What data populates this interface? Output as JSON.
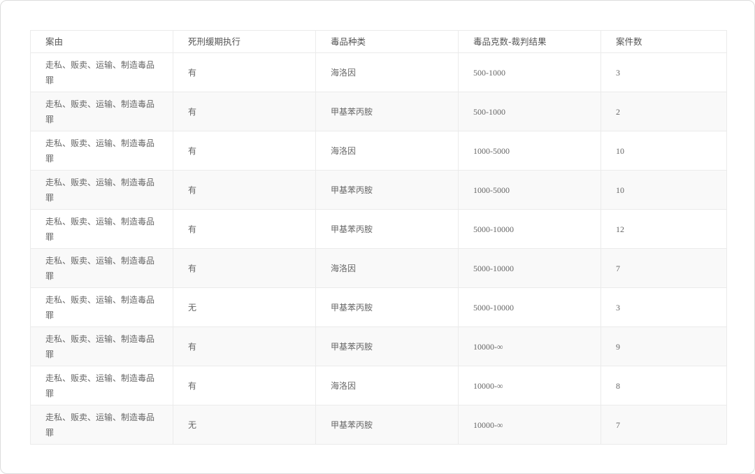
{
  "table": {
    "headers": [
      "案由",
      "死刑缓期执行",
      "毒品种类",
      "毒品克数-裁判结果",
      "案件数"
    ],
    "rows": [
      [
        "走私、贩卖、运输、制造毒品罪",
        "有",
        "海洛因",
        "500-1000",
        "3"
      ],
      [
        "走私、贩卖、运输、制造毒品罪",
        "有",
        "甲基苯丙胺",
        "500-1000",
        "2"
      ],
      [
        "走私、贩卖、运输、制造毒品罪",
        "有",
        "海洛因",
        "1000-5000",
        "10"
      ],
      [
        "走私、贩卖、运输、制造毒品罪",
        "有",
        "甲基苯丙胺",
        "1000-5000",
        "10"
      ],
      [
        "走私、贩卖、运输、制造毒品罪",
        "有",
        "甲基苯丙胺",
        "5000-10000",
        "12"
      ],
      [
        "走私、贩卖、运输、制造毒品罪",
        "有",
        "海洛因",
        "5000-10000",
        "7"
      ],
      [
        "走私、贩卖、运输、制造毒品罪",
        "无",
        "甲基苯丙胺",
        "5000-10000",
        "3"
      ],
      [
        "走私、贩卖、运输、制造毒品罪",
        "有",
        "甲基苯丙胺",
        "10000-∞",
        "9"
      ],
      [
        "走私、贩卖、运输、制造毒品罪",
        "有",
        "海洛因",
        "10000-∞",
        "8"
      ],
      [
        "走私、贩卖、运输、制造毒品罪",
        "无",
        "甲基苯丙胺",
        "10000-∞",
        "7"
      ]
    ]
  }
}
